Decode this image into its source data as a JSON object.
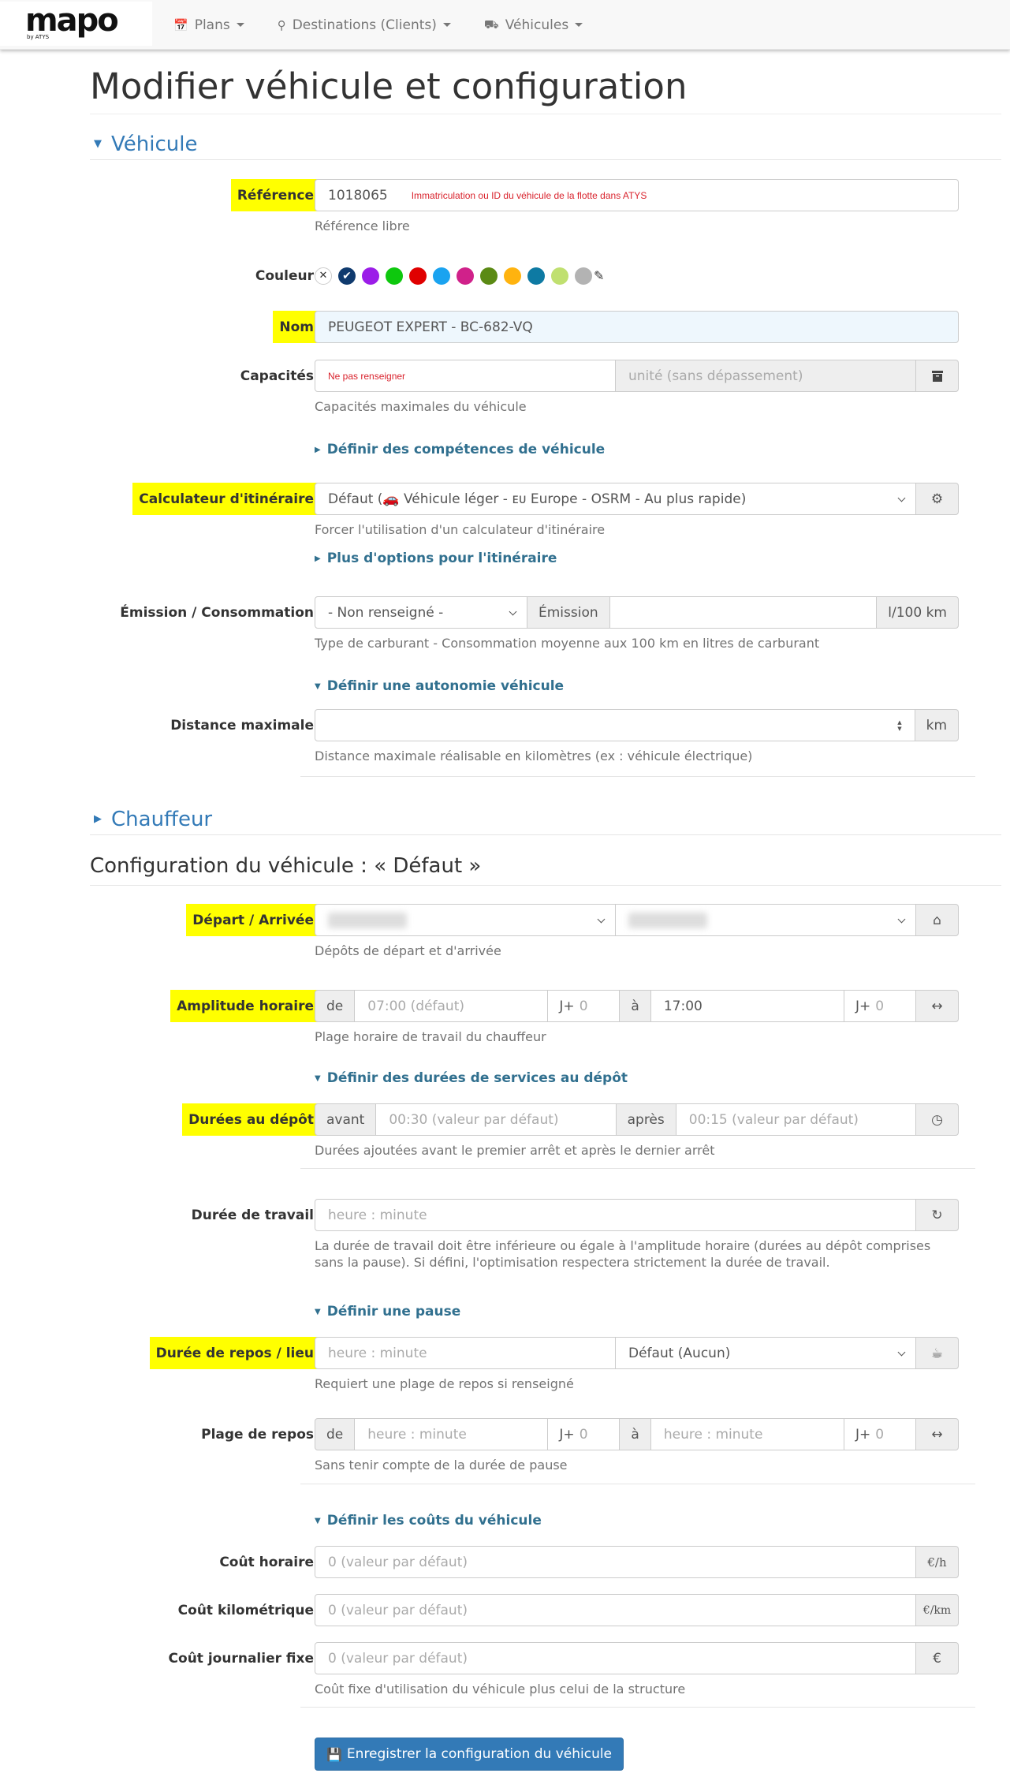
{
  "navbar": {
    "brand": "mapo",
    "brand_sub": "by ATYS",
    "items": [
      {
        "label": "Plans",
        "icon": "calendar-icon"
      },
      {
        "label": "Destinations (Clients)",
        "icon": "map-marker-icon"
      },
      {
        "label": "Véhicules",
        "icon": "truck-icon"
      }
    ]
  },
  "page": {
    "title": "Modifier véhicule et configuration",
    "section_vehicle": "Véhicule",
    "section_driver": "Chauffeur",
    "config_title": "Configuration du véhicule : « Défaut »"
  },
  "vehicle": {
    "reference": {
      "label": "Référence",
      "value": "1018065",
      "note": "Immatriculation ou ID du véhicule de la flotte dans ATYS",
      "help": "Référence libre"
    },
    "color": {
      "label": "Couleur",
      "swatches": [
        "#ffffff",
        "#0f3a6e",
        "#9b1de8",
        "#0ec80e",
        "#e00000",
        "#1aa3f0",
        "#d0218a",
        "#5b8a14",
        "#ffb30f",
        "#0e7aa3",
        "#c0e070",
        "#b3b3b3"
      ],
      "selected_index": 1
    },
    "name": {
      "label": "Nom",
      "value": "PEUGEOT EXPERT - BC-682-VQ"
    },
    "capacities": {
      "label": "Capacités",
      "note": "Ne pas renseigner",
      "unit_placeholder": "unité (sans dépassement)",
      "help": "Capacités maximales du véhicule"
    },
    "skills_link": "Définir des compétences de véhicule",
    "router": {
      "label": "Calculateur d'itinéraire",
      "value": "Défaut (🚗 Véhicule léger - ᴇᴜ Europe - OSRM - Au plus rapide)",
      "help": "Forcer l'utilisation d'un calculateur d'itinéraire"
    },
    "router_options_link": "Plus d'options pour l'itinéraire",
    "emission": {
      "label": "Émission / Consommation",
      "fuel_value": "- Non renseigné -",
      "emission_addon": "Émission",
      "consumption_value": "",
      "unit": "l/100 km",
      "help": "Type de carburant - Consommation moyenne aux 100 km en litres de carburant"
    },
    "autonomy_link": "Définir une autonomie véhicule",
    "max_distance": {
      "label": "Distance maximale",
      "value": "",
      "unit": "km",
      "help": "Distance maximale réalisable en kilomètres (ex : véhicule électrique)"
    }
  },
  "config": {
    "depots": {
      "label": "Départ / Arrivée",
      "help": "Dépôts de départ et d'arrivée"
    },
    "time_window": {
      "label": "Amplitude horaire",
      "from_addon": "de",
      "from_placeholder": "07:00 (défaut)",
      "day_addon": "J+",
      "from_day_placeholder": "0",
      "to_addon": "à",
      "to_value": "17:00",
      "to_day_placeholder": "0",
      "help": "Plage horaire de travail du chauffeur"
    },
    "service_link": "Définir des durées de services au dépôt",
    "service": {
      "label": "Durées au dépôt",
      "before_addon": "avant",
      "before_placeholder": "00:30 (valeur par défaut)",
      "after_addon": "après",
      "after_placeholder": "00:15 (valeur par défaut)",
      "help": "Durées ajoutées avant le premier arrêt et après le dernier arrêt"
    },
    "work_duration": {
      "label": "Durée de travail",
      "placeholder": "heure : minute",
      "help": "La durée de travail doit être inférieure ou égale à l'amplitude horaire (durées au dépôt comprises sans la pause). Si défini, l'optimisation respectera strictement la durée de travail."
    },
    "pause_link": "Définir une pause",
    "rest": {
      "label": "Durée de repos / lieu",
      "placeholder": "heure : minute",
      "place_value": "Défaut (Aucun)",
      "help": "Requiert une plage de repos si renseigné"
    },
    "rest_window": {
      "label": "Plage de repos",
      "from_addon": "de",
      "from_placeholder": "heure : minute",
      "day_addon": "J+",
      "from_day_placeholder": "0",
      "to_addon": "à",
      "to_placeholder": "heure : minute",
      "to_day_placeholder": "0",
      "help": "Sans tenir compte de la durée de pause"
    },
    "costs_link": "Définir les coûts du véhicule",
    "cost_hour": {
      "label": "Coût horaire",
      "placeholder": "0 (valeur par défaut)",
      "unit": "€/h"
    },
    "cost_km": {
      "label": "Coût kilométrique",
      "placeholder": "0 (valeur par défaut)",
      "unit": "€/km"
    },
    "cost_fixed": {
      "label": "Coût journalier fixe",
      "placeholder": "0 (valeur par défaut)",
      "unit": "€",
      "help": "Coût fixe d'utilisation du véhicule plus celui de la structure"
    },
    "save_button": "Enregistrer la configuration du véhicule"
  }
}
